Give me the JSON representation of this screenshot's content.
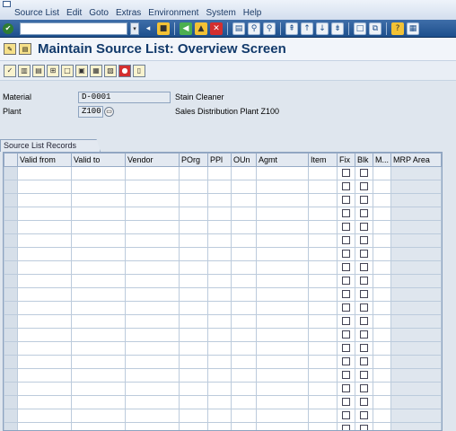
{
  "menubar": {
    "items": [
      "Source List",
      "Edit",
      "Goto",
      "Extras",
      "Environment",
      "System",
      "Help"
    ]
  },
  "toolbar": {
    "command_value": ""
  },
  "title": "Maintain Source List: Overview Screen",
  "header": {
    "material_label": "Material",
    "material_value": "D-0001",
    "material_desc": "Stain Cleaner",
    "plant_label": "Plant",
    "plant_value": "Z100",
    "plant_desc": "Sales Distribution Plant Z100"
  },
  "tab": {
    "label": "Source List Records"
  },
  "table": {
    "columns": [
      "Valid from",
      "Valid to",
      "Vendor",
      "POrg",
      "PPl",
      "OUn",
      "Agmt",
      "Item",
      "Fix",
      "Blk",
      "M...",
      "MRP Area"
    ],
    "row_count": 20
  }
}
